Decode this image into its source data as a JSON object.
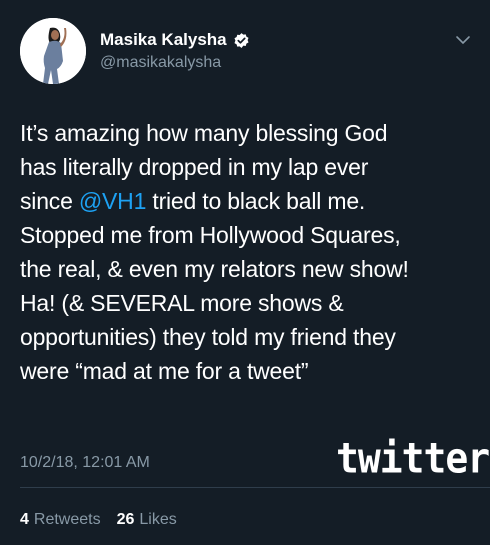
{
  "user": {
    "display_name": "Masika Kalysha",
    "handle": "@masikakalysha",
    "avatar_icon": "profile-photo",
    "verified_icon": "verified-badge-icon"
  },
  "tweet": {
    "lines": [
      "It’s amazing how many blessing God",
      "has literally dropped in my lap ever",
      "since ",
      "Stopped me from Hollywood Squares,",
      "the real, & even my relators new show!",
      "Ha! (& SEVERAL more shows &",
      "opportunities) they told my friend they",
      "were “mad at me for a tweet”"
    ],
    "mention": "@VH1",
    "line3_rest": " tried to black ball me."
  },
  "timestamp": "10/2/18, 12:01 AM",
  "watermark": "twitter",
  "stats": {
    "retweets_count": "4",
    "retweets_label": "Retweets",
    "likes_count": "26",
    "likes_label": "Likes"
  },
  "colors": {
    "background": "#141d26",
    "text": "#ffffff",
    "secondary_text": "#8899a6",
    "link": "#1da1f2",
    "verified": "#ffffff"
  }
}
